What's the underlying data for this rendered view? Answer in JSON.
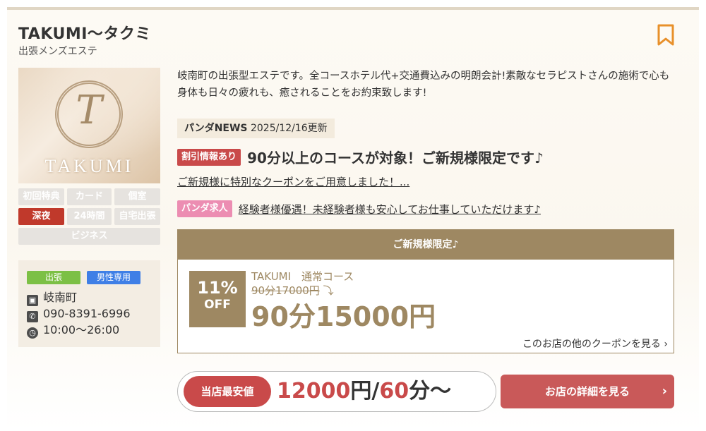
{
  "shop": {
    "name": "TAKUMI〜タクミ",
    "category": "出張メンズエステ",
    "logo_initial": "T",
    "logo_text": "TAKUMI"
  },
  "tags": [
    {
      "label": "初回特典",
      "active": false
    },
    {
      "label": "カード",
      "active": false
    },
    {
      "label": "個室",
      "active": false
    },
    {
      "label": "深夜",
      "active": true
    },
    {
      "label": "24時間",
      "active": false
    },
    {
      "label": "自宅出張",
      "active": false
    },
    {
      "label": "ビジネス",
      "active": false
    }
  ],
  "info": {
    "badge_type": "出張",
    "badge_gender": "男性専用",
    "area": "岐南町",
    "phone": "090-8391-6996",
    "hours": "10:00〜26:00"
  },
  "description": "岐南町の出張型エステです。全コースホテル代+交通費込みの明朗会計!素敵なセラピストさんの施術で心も身体も日々の疲れも、癒されることをお約束致します!",
  "news": {
    "label": "パンダNEWS",
    "date": "2025/12/16更新",
    "discount_label": "割引情報あり",
    "discount_headline": "90分以上のコースが対象！ご新規様限定です♪",
    "discount_link": "ご新規様に特別なクーポンをご用意しました！...",
    "job_label": "パンダ求人",
    "job_link": "経験者様優遇！未経験者様も安心してお仕事していただけます♪"
  },
  "coupon": {
    "header": "ご新規様限定♪",
    "percent": "11%",
    "off": "OFF",
    "course": "TAKUMI　通常コース",
    "old_price": "90分17000円",
    "new_price": "90分15000円",
    "more_link": "このお店の他のクーポンを見る"
  },
  "price": {
    "label": "当店最安値",
    "amount": "12000",
    "yen": "円/",
    "minutes": "60",
    "suffix": "分〜"
  },
  "cta": {
    "label": "お店の詳細を見る"
  },
  "colors": {
    "accent_brown": "#9e8862",
    "accent_red": "#c94a4a",
    "bookmark": "#e8902a"
  }
}
